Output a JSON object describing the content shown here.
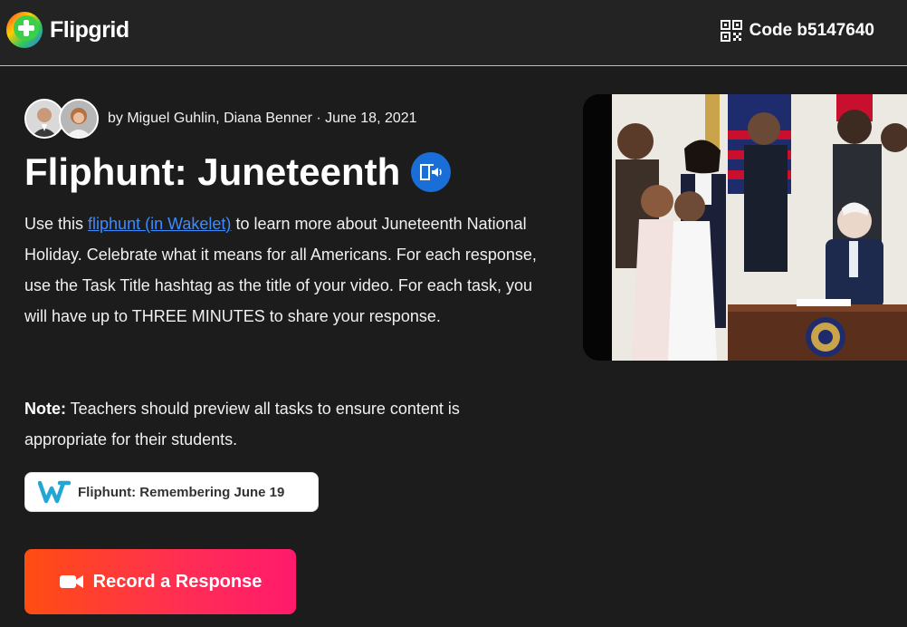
{
  "header": {
    "brand": "Flipgrid",
    "code_label": "Code b5147640"
  },
  "topic": {
    "byline": "by Miguel Guhlin, Diana Benner · June 18, 2021",
    "title": "Fliphunt: Juneteenth",
    "description": {
      "prefix": "Use this ",
      "link_text": "fliphunt (in Wakelet)",
      "suffix": " to learn more about Juneteenth National Holiday. Celebrate what it means for all Americans. For each response, use the Task Title hashtag as the title of your video. For each task, you will have up to THREE MINUTES to share your response."
    },
    "note": {
      "label": "Note:",
      "text": " Teachers should preview all tasks to ensure content is appropriate for their students."
    },
    "resource_label": "Fliphunt: Remembering June 19",
    "record_label": "Record a Response"
  },
  "icons": {
    "logo": "flipgrid-logo-icon",
    "qr": "qr-code-icon",
    "immersive_reader": "immersive-reader-icon",
    "wakelet": "wakelet-icon",
    "camera": "video-camera-icon"
  },
  "colors": {
    "background": "#1c1c1c",
    "link": "#3d8bfd",
    "accent_blue": "#1a6ed8",
    "record_gradient_start": "#ff4d12",
    "record_gradient_end": "#ff1a6c"
  }
}
